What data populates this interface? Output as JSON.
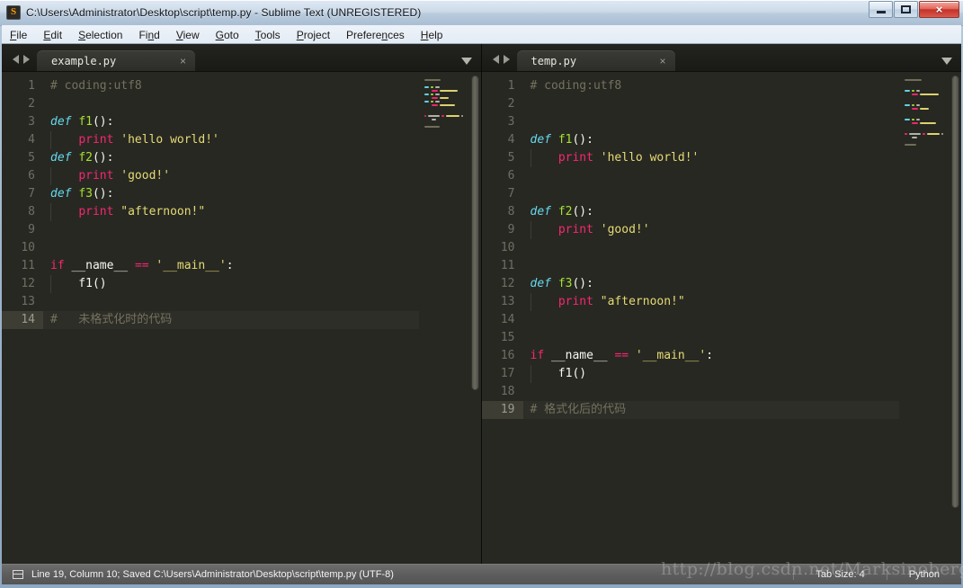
{
  "window": {
    "title": "C:\\Users\\Administrator\\Desktop\\script\\temp.py - Sublime Text (UNREGISTERED)",
    "app_icon": "sublime-text-icon",
    "controls": {
      "minimize": "minimize-icon",
      "maximize": "maximize-icon",
      "close": "×"
    }
  },
  "menubar": {
    "items": [
      {
        "label": "File",
        "pre": "",
        "acc": "F",
        "post": "ile"
      },
      {
        "label": "Edit",
        "pre": "",
        "acc": "E",
        "post": "dit"
      },
      {
        "label": "Selection",
        "pre": "",
        "acc": "S",
        "post": "election"
      },
      {
        "label": "Find",
        "pre": "Fi",
        "acc": "n",
        "post": "d"
      },
      {
        "label": "View",
        "pre": "",
        "acc": "V",
        "post": "iew"
      },
      {
        "label": "Goto",
        "pre": "",
        "acc": "G",
        "post": "oto"
      },
      {
        "label": "Tools",
        "pre": "",
        "acc": "T",
        "post": "ools"
      },
      {
        "label": "Project",
        "pre": "",
        "acc": "P",
        "post": "roject"
      },
      {
        "label": "Preferences",
        "pre": "Prefere",
        "acc": "n",
        "post": "ces"
      },
      {
        "label": "Help",
        "pre": "",
        "acc": "H",
        "post": "elp"
      }
    ]
  },
  "panes": {
    "left": {
      "tab": {
        "label": "example.py",
        "close": "×"
      },
      "active_line": 14,
      "scroll": {
        "top_pct": 0,
        "height_pct": 64
      },
      "lines": [
        {
          "n": 1,
          "indent": false,
          "tokens": [
            {
              "t": "# coding:utf8",
              "c": "t-com"
            }
          ]
        },
        {
          "n": 2,
          "indent": false,
          "tokens": []
        },
        {
          "n": 3,
          "indent": false,
          "tokens": [
            {
              "t": "def ",
              "c": "t-def"
            },
            {
              "t": "f1",
              "c": "t-fn"
            },
            {
              "t": "():",
              "c": "t-pun"
            }
          ]
        },
        {
          "n": 4,
          "indent": true,
          "tokens": [
            {
              "t": "    ",
              "c": "t-pun"
            },
            {
              "t": "print",
              "c": "t-kw"
            },
            {
              "t": " ",
              "c": "t-pun"
            },
            {
              "t": "'hello world!'",
              "c": "t-str"
            }
          ]
        },
        {
          "n": 5,
          "indent": false,
          "tokens": [
            {
              "t": "def ",
              "c": "t-def"
            },
            {
              "t": "f2",
              "c": "t-fn"
            },
            {
              "t": "():",
              "c": "t-pun"
            }
          ]
        },
        {
          "n": 6,
          "indent": true,
          "tokens": [
            {
              "t": "    ",
              "c": "t-pun"
            },
            {
              "t": "print",
              "c": "t-kw"
            },
            {
              "t": " ",
              "c": "t-pun"
            },
            {
              "t": "'good!'",
              "c": "t-str"
            }
          ]
        },
        {
          "n": 7,
          "indent": false,
          "tokens": [
            {
              "t": "def ",
              "c": "t-def"
            },
            {
              "t": "f3",
              "c": "t-fn"
            },
            {
              "t": "():",
              "c": "t-pun"
            }
          ]
        },
        {
          "n": 8,
          "indent": true,
          "tokens": [
            {
              "t": "    ",
              "c": "t-pun"
            },
            {
              "t": "print",
              "c": "t-kw"
            },
            {
              "t": " ",
              "c": "t-pun"
            },
            {
              "t": "\"afternoon!\"",
              "c": "t-str"
            }
          ]
        },
        {
          "n": 9,
          "indent": false,
          "tokens": []
        },
        {
          "n": 10,
          "indent": false,
          "tokens": []
        },
        {
          "n": 11,
          "indent": false,
          "tokens": [
            {
              "t": "if",
              "c": "t-kw"
            },
            {
              "t": " __name__ ",
              "c": "t-var"
            },
            {
              "t": "==",
              "c": "t-op"
            },
            {
              "t": " ",
              "c": "t-pun"
            },
            {
              "t": "'__main__'",
              "c": "t-str"
            },
            {
              "t": ":",
              "c": "t-pun"
            }
          ]
        },
        {
          "n": 12,
          "indent": true,
          "tokens": [
            {
              "t": "    f1()",
              "c": "t-pun"
            }
          ]
        },
        {
          "n": 13,
          "indent": false,
          "tokens": []
        },
        {
          "n": 14,
          "indent": false,
          "tokens": [
            {
              "t": "#   未格式化时的代码",
              "c": "t-com"
            }
          ]
        }
      ]
    },
    "right": {
      "tab": {
        "label": "temp.py",
        "close": "×"
      },
      "active_line": 19,
      "scroll": {
        "top_pct": 0,
        "height_pct": 88
      },
      "lines": [
        {
          "n": 1,
          "indent": false,
          "tokens": [
            {
              "t": "# coding:utf8",
              "c": "t-com"
            }
          ]
        },
        {
          "n": 2,
          "indent": false,
          "tokens": []
        },
        {
          "n": 3,
          "indent": false,
          "tokens": []
        },
        {
          "n": 4,
          "indent": false,
          "tokens": [
            {
              "t": "def ",
              "c": "t-def"
            },
            {
              "t": "f1",
              "c": "t-fn"
            },
            {
              "t": "():",
              "c": "t-pun"
            }
          ]
        },
        {
          "n": 5,
          "indent": true,
          "tokens": [
            {
              "t": "    ",
              "c": "t-pun"
            },
            {
              "t": "print",
              "c": "t-kw"
            },
            {
              "t": " ",
              "c": "t-pun"
            },
            {
              "t": "'hello world!'",
              "c": "t-str"
            }
          ]
        },
        {
          "n": 6,
          "indent": false,
          "tokens": []
        },
        {
          "n": 7,
          "indent": false,
          "tokens": []
        },
        {
          "n": 8,
          "indent": false,
          "tokens": [
            {
              "t": "def ",
              "c": "t-def"
            },
            {
              "t": "f2",
              "c": "t-fn"
            },
            {
              "t": "():",
              "c": "t-pun"
            }
          ]
        },
        {
          "n": 9,
          "indent": true,
          "tokens": [
            {
              "t": "    ",
              "c": "t-pun"
            },
            {
              "t": "print",
              "c": "t-kw"
            },
            {
              "t": " ",
              "c": "t-pun"
            },
            {
              "t": "'good!'",
              "c": "t-str"
            }
          ]
        },
        {
          "n": 10,
          "indent": false,
          "tokens": []
        },
        {
          "n": 11,
          "indent": false,
          "tokens": []
        },
        {
          "n": 12,
          "indent": false,
          "tokens": [
            {
              "t": "def ",
              "c": "t-def"
            },
            {
              "t": "f3",
              "c": "t-fn"
            },
            {
              "t": "():",
              "c": "t-pun"
            }
          ]
        },
        {
          "n": 13,
          "indent": true,
          "tokens": [
            {
              "t": "    ",
              "c": "t-pun"
            },
            {
              "t": "print",
              "c": "t-kw"
            },
            {
              "t": " ",
              "c": "t-pun"
            },
            {
              "t": "\"afternoon!\"",
              "c": "t-str"
            }
          ]
        },
        {
          "n": 14,
          "indent": false,
          "tokens": []
        },
        {
          "n": 15,
          "indent": false,
          "tokens": []
        },
        {
          "n": 16,
          "indent": false,
          "tokens": [
            {
              "t": "if",
              "c": "t-kw"
            },
            {
              "t": " __name__ ",
              "c": "t-var"
            },
            {
              "t": "==",
              "c": "t-op"
            },
            {
              "t": " ",
              "c": "t-pun"
            },
            {
              "t": "'__main__'",
              "c": "t-str"
            },
            {
              "t": ":",
              "c": "t-pun"
            }
          ]
        },
        {
          "n": 17,
          "indent": true,
          "tokens": [
            {
              "t": "    f1()",
              "c": "t-pun"
            }
          ]
        },
        {
          "n": 18,
          "indent": false,
          "tokens": []
        },
        {
          "n": 19,
          "indent": false,
          "tokens": [
            {
              "t": "# 格式化后的代码",
              "c": "t-com"
            }
          ]
        }
      ]
    }
  },
  "statusbar": {
    "icon": "layout-icon",
    "message": "Line 19, Column 10; Saved C:\\Users\\Administrator\\Desktop\\script\\temp.py (UTF-8)",
    "tab_size": "Tab Size: 4",
    "syntax": "Python"
  },
  "watermark": "http://blog.csdn.net/Marksinoberg",
  "colors": {
    "editor_bg": "#272822",
    "comment": "#75715e",
    "keyword": "#f92672",
    "storage": "#66d9ef",
    "function": "#a6e22e",
    "string": "#e6db74",
    "foreground": "#f8f8f2",
    "active_line_gutter": "#3d3d33",
    "chrome": "#1b1b18",
    "statusbar": "#5d5d5d"
  }
}
